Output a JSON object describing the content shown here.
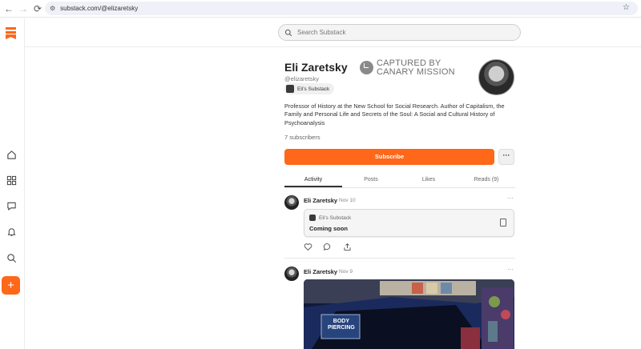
{
  "browser": {
    "url": "substack.com/@elizaretsky",
    "back_icon": "←",
    "forward_icon": "→",
    "reload_icon": "⟳",
    "star_icon": "☆"
  },
  "search": {
    "placeholder": "Search Substack"
  },
  "profile": {
    "name": "Eli Zaretsky",
    "handle": "@elizaretsky",
    "publication": "Eli's Substack",
    "bio": "Professor of History at the New School for Social Research. Author of Capitalism, the Family and Personal Life and Secrets of the Soul: A Social and Cultural History of Psychoanalysis",
    "subscribers": "7 subscribers",
    "subscribe_label": "Subscribe",
    "more_label": "···"
  },
  "watermark": {
    "line1": "CAPTURED BY",
    "line2": "CANARY MISSION"
  },
  "tabs": [
    {
      "label": "Activity"
    },
    {
      "label": "Posts"
    },
    {
      "label": "Likes"
    },
    {
      "label": "Reads (9)"
    }
  ],
  "feed": [
    {
      "author": "Eli Zaretsky",
      "date": "Nov 10",
      "menu": "···",
      "embed": {
        "publication": "Eli's Substack",
        "title": "Coming soon"
      }
    },
    {
      "author": "Eli Zaretsky",
      "date": "Nov 9",
      "menu": "···",
      "image_sign": {
        "line1": "BODY",
        "line2": "PIERCING"
      }
    }
  ],
  "colors": {
    "accent": "#ff6719"
  }
}
